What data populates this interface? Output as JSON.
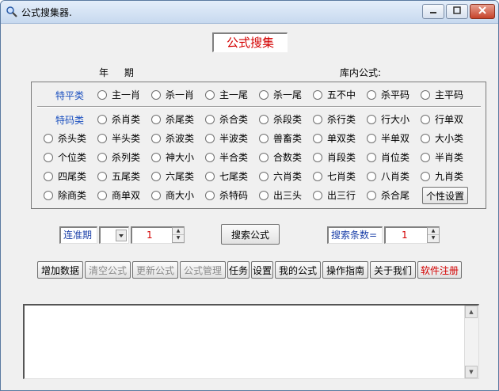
{
  "window": {
    "title": "公式搜集器."
  },
  "heading": "公式搜集",
  "labels": {
    "period": "年 期",
    "library": "库内公式:"
  },
  "radio_rows": [
    {
      "category": "特平类",
      "options": [
        "主一肖",
        "杀一肖",
        "主一尾",
        "杀一尾",
        "五不中",
        "杀平码",
        "主平码"
      ]
    },
    {
      "category": "特码类",
      "options": [
        "杀肖类",
        "杀尾类",
        "杀合类",
        "杀段类",
        "杀行类",
        "行大小",
        "行单双"
      ]
    },
    {
      "category": "",
      "options": [
        "杀头类",
        "半头类",
        "杀波类",
        "半波类",
        "兽畜类",
        "单双类",
        "半单双",
        "大小类"
      ]
    },
    {
      "category": "",
      "options": [
        "个位类",
        "杀列类",
        "神大小",
        "半合类",
        "合数类",
        "肖段类",
        "肖位类",
        "半肖类"
      ]
    },
    {
      "category": "",
      "options": [
        "四尾类",
        "五尾类",
        "六尾类",
        "七尾类",
        "六肖类",
        "七肖类",
        "八肖类",
        "九肖类"
      ]
    },
    {
      "category": "",
      "options": [
        "除商类",
        "商单双",
        "商大小",
        "杀特码",
        "出三头",
        "出三行",
        "杀合尾"
      ]
    }
  ],
  "personal_settings": "个性设置",
  "controls": {
    "streak_label": "连准期",
    "streak_value": "1",
    "search_button": "搜索公式",
    "count_label": "搜索条数=",
    "count_value": "1"
  },
  "toolbar": [
    {
      "label": "增加数据",
      "state": "enabled"
    },
    {
      "label": "清空公式",
      "state": "disabled"
    },
    {
      "label": "更新公式",
      "state": "disabled"
    },
    {
      "label": "公式管理",
      "state": "disabled"
    },
    {
      "label": "任务",
      "state": "enabled"
    },
    {
      "label": "设置",
      "state": "enabled"
    },
    {
      "label": "我的公式",
      "state": "enabled"
    },
    {
      "label": "操作指南",
      "state": "enabled"
    },
    {
      "label": "关于我们",
      "state": "enabled"
    },
    {
      "label": "软件注册",
      "state": "accent"
    }
  ],
  "colors": {
    "category": "#1a4fbf",
    "accent": "#d40000",
    "frame": "#5a7aa0"
  },
  "icons": {
    "app": "magnifier-icon",
    "minimize": "minimize-icon",
    "maximize": "maximize-icon",
    "close": "close-icon"
  }
}
